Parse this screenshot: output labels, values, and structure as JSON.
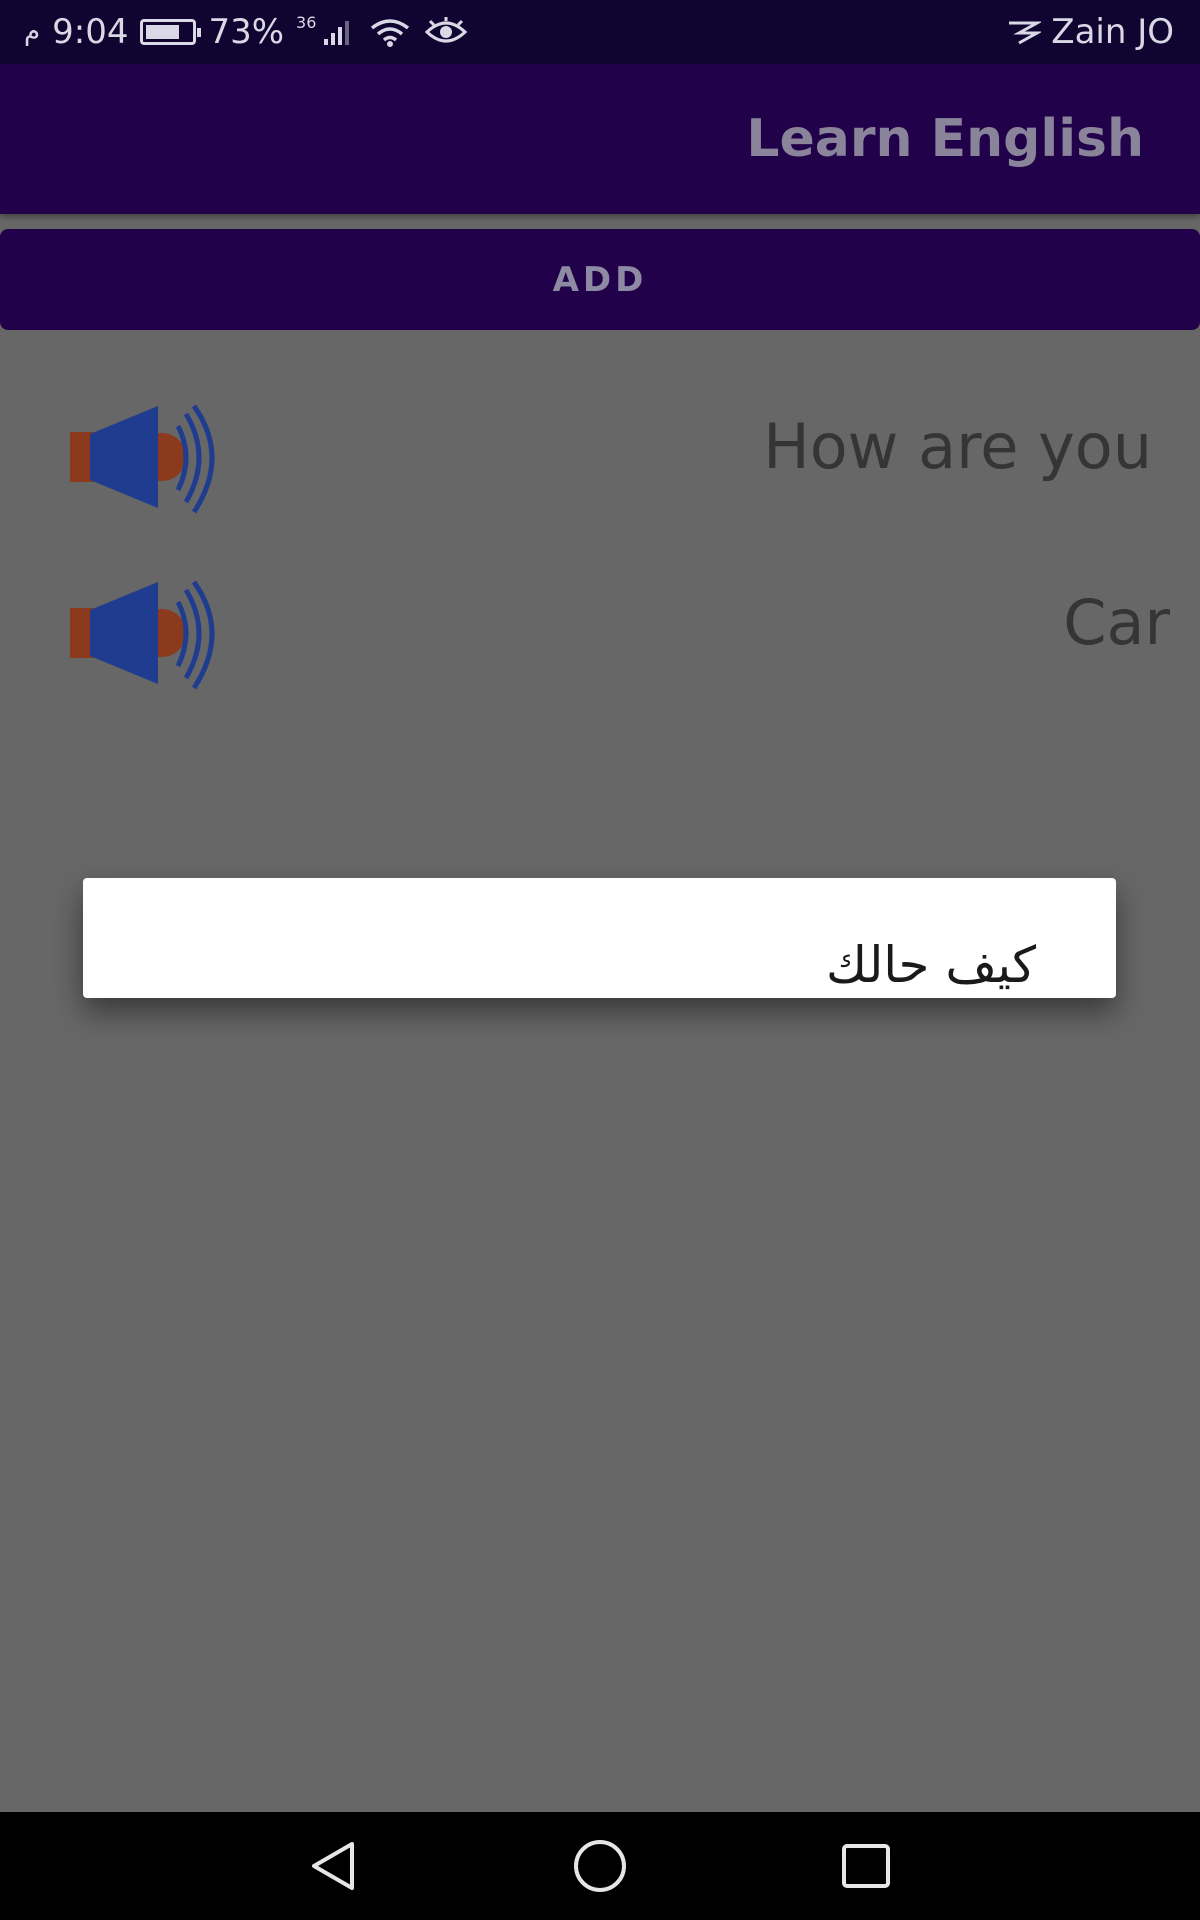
{
  "status_bar": {
    "ampm": "م",
    "time": "9:04",
    "battery_percent": "73%",
    "battery_level": 0.73,
    "network_type": "36",
    "carrier": "Zain JO"
  },
  "app_bar": {
    "title": "Learn English"
  },
  "toolbar": {
    "add_label": "ADD"
  },
  "words": [
    {
      "text": "How are you"
    },
    {
      "text": "Car"
    }
  ],
  "popup": {
    "text": "كيف حالك"
  },
  "colors": {
    "status_bar_bg": "#100530",
    "app_bar_bg": "#21024a",
    "scrim_bg": "#676767",
    "speaker_cone": "#1f3c8f",
    "speaker_base": "#8b3a1e"
  }
}
